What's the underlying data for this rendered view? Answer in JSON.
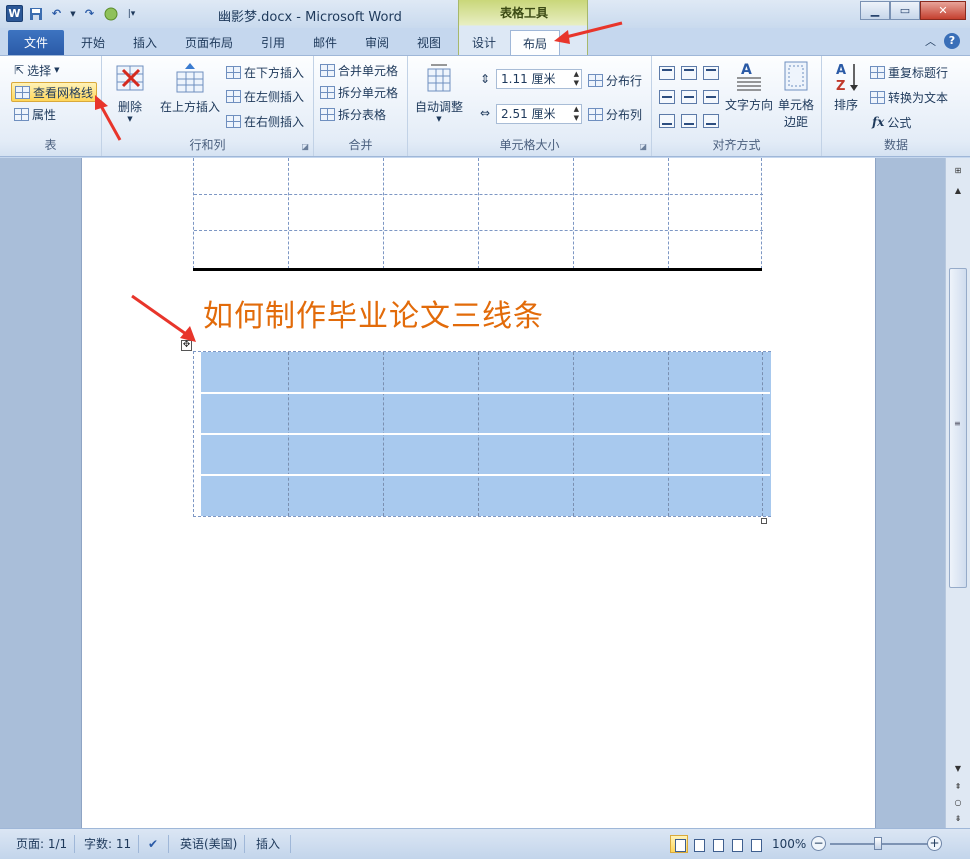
{
  "window": {
    "title": "幽影梦.docx - Microsoft Word",
    "context_group": "表格工具",
    "logo_letter": "W"
  },
  "tabs": [
    {
      "label": "文件"
    },
    {
      "label": "开始"
    },
    {
      "label": "插入"
    },
    {
      "label": "页面布局"
    },
    {
      "label": "引用"
    },
    {
      "label": "邮件"
    },
    {
      "label": "审阅"
    },
    {
      "label": "视图"
    },
    {
      "label": "设计"
    },
    {
      "label": "布局"
    }
  ],
  "active_tab": "布局",
  "ribbon": {
    "table_group": {
      "label": "表",
      "select": "选择",
      "view_gridlines": "查看网格线",
      "properties": "属性"
    },
    "rows_cols_group": {
      "label": "行和列",
      "delete": "删除",
      "insert_above": "在上方插入",
      "insert_below": "在下方插入",
      "insert_left": "在左侧插入",
      "insert_right": "在右侧插入"
    },
    "merge_group": {
      "label": "合并",
      "merge_cells": "合并单元格",
      "split_cells": "拆分单元格",
      "split_table": "拆分表格"
    },
    "cell_size_group": {
      "label": "单元格大小",
      "autofit": "自动调整",
      "height_value": "1.11 厘米",
      "width_value": "2.51 厘米",
      "distribute_rows": "分布行",
      "distribute_cols": "分布列"
    },
    "alignment_group": {
      "label": "对齐方式",
      "text_direction": "文字方向",
      "cell_margins_1": "单元格",
      "cell_margins_2": "边距"
    },
    "data_group": {
      "label": "数据",
      "sort": "排序",
      "repeat_header": "重复标题行",
      "convert_to_text": "转换为文本",
      "formula": "公式"
    }
  },
  "document": {
    "heading": "如何制作毕业论文三线条"
  },
  "statusbar": {
    "page": "页面: 1/1",
    "words": "字数: 11",
    "language": "英语(美国)",
    "mode": "插入",
    "zoom": "100%"
  },
  "colors": {
    "heading": "#e26b0a",
    "selection": "#a8c9ee",
    "arrow": "#e8352b"
  }
}
